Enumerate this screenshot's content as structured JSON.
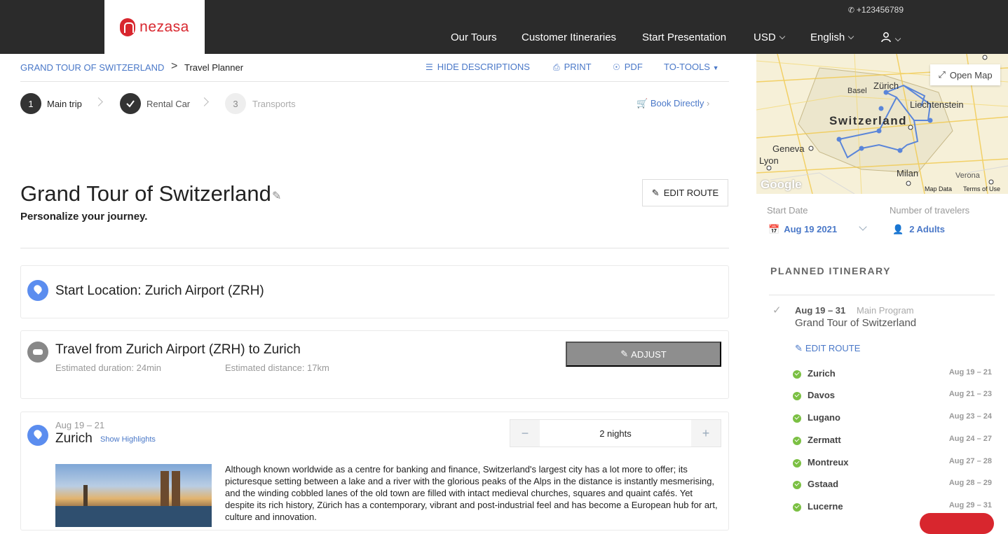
{
  "header": {
    "logo_text": "nezasa",
    "phone": "+123456789",
    "nav": [
      {
        "label": "Our Tours"
      },
      {
        "label": "Customer Itineraries"
      },
      {
        "label": "Start Presentation"
      },
      {
        "label": "USD"
      },
      {
        "label": "English"
      }
    ]
  },
  "breadcrumb": {
    "parent": "GRAND TOUR OF SWITZERLAND",
    "separator": ">",
    "current": "Travel Planner"
  },
  "toolbar": {
    "hide_descriptions": "HIDE DESCRIPTIONS",
    "print": "PRINT",
    "pdf": "PDF",
    "to_tools": "TO-TOOLS"
  },
  "steps": [
    {
      "number": "1",
      "label": "Main trip",
      "state": "active"
    },
    {
      "number": "",
      "label": "Rental Car",
      "state": "done"
    },
    {
      "number": "3",
      "label": "Transports",
      "state": "pending"
    }
  ],
  "book_directly": "Book Directly",
  "trip": {
    "title": "Grand Tour of Switzerland",
    "subtitle": "Personalize your journey.",
    "edit_route": "EDIT ROUTE"
  },
  "start_location": "Start Location: Zurich Airport (ZRH)",
  "transfer": {
    "title": "Travel from Zurich Airport (ZRH) to Zurich",
    "duration": "Estimated duration: 24min",
    "distance": "Estimated distance: 17km",
    "adjust": "ADJUST"
  },
  "stop_card": {
    "dates": "Aug 19 – 21",
    "city": "Zurich",
    "highlights": "Show Highlights",
    "nights": "2 nights",
    "minus": "−",
    "plus": "+",
    "description": "Although known worldwide as a centre for banking and finance, Switzerland's largest city has a lot more to offer; its picturesque setting between a lake and a river with the glorious peaks of the Alps in the distance is instantly mesmerising, and the winding cobbled lanes of the old town are filled with intact medieval churches, squares and quaint cafés. Yet despite its rich history, Zürich has a contemporary, vibrant and post-industrial feel and has become a European hub for art, culture and innovation."
  },
  "map": {
    "open_map": "Open Map",
    "labels": {
      "zurich": "Zürich",
      "basel": "Basel",
      "liechtenstein": "Liechtenstein",
      "switzerland": "Switzerland",
      "geneva": "Geneva",
      "lyon": "Lyon",
      "milan": "Milan",
      "verona": "Verona",
      "google": "Google",
      "map_data": "Map Data",
      "terms": "Terms of Use"
    }
  },
  "booking": {
    "start_date_label": "Start Date",
    "start_date": "Aug 19 2021",
    "travelers_label": "Number of travelers",
    "travelers": "2 Adults"
  },
  "itinerary": {
    "heading": "PLANNED ITINERARY",
    "program_dates": "Aug 19 – 31",
    "program_type": "Main Program",
    "program_title": "Grand Tour of Switzerland",
    "edit_route": "EDIT ROUTE",
    "stops": [
      {
        "name": "Zurich",
        "dates": "Aug 19 – 21"
      },
      {
        "name": "Davos",
        "dates": "Aug 21 – 23"
      },
      {
        "name": "Lugano",
        "dates": "Aug 23 – 24"
      },
      {
        "name": "Zermatt",
        "dates": "Aug 24 – 27"
      },
      {
        "name": "Montreux",
        "dates": "Aug 27 – 28"
      },
      {
        "name": "Gstaad",
        "dates": "Aug 28 – 29"
      },
      {
        "name": "Lucerne",
        "dates": "Aug 29 – 31"
      }
    ]
  },
  "colors": {
    "topbar": "#2b2b2b",
    "brand": "#d8262e",
    "link": "#4a78c8",
    "success": "#7bc043"
  }
}
